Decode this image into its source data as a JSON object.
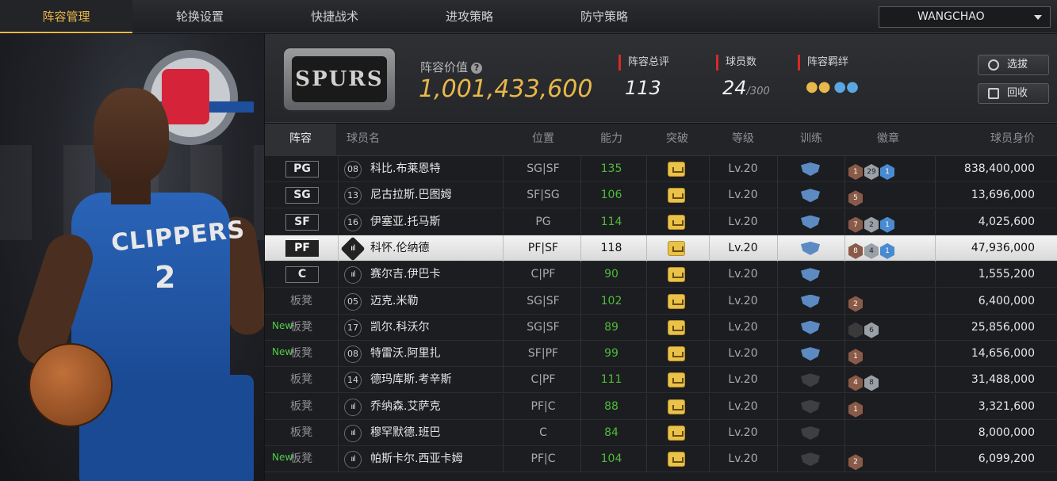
{
  "nav": {
    "tabs": [
      {
        "label": "阵容管理",
        "active": true
      },
      {
        "label": "轮换设置",
        "active": false
      },
      {
        "label": "快捷战术",
        "active": false
      },
      {
        "label": "进攻策略",
        "active": false
      },
      {
        "label": "防守策略",
        "active": false
      }
    ],
    "user": "WANGCHAO"
  },
  "team": {
    "logo_text": "SPURS",
    "value_label": "阵容价值",
    "value": "1,001,433,600",
    "rating_label": "阵容总评",
    "rating": "113",
    "players_label": "球员数",
    "players": "24",
    "players_max": "/300",
    "bond_label": "阵容羁绊",
    "btn_select": "选拔",
    "btn_recycle": "回收"
  },
  "player_art": {
    "jersey_text": "CLIPPERS",
    "jersey_number": "2"
  },
  "table": {
    "headers": [
      "阵容",
      "球员名",
      "位置",
      "能力",
      "突破",
      "等级",
      "训练",
      "徽章",
      "球员身价"
    ],
    "rows": [
      {
        "slot": "PG",
        "slot_type": "starter",
        "new": "",
        "jersey": "08",
        "name": "科比.布莱恩特",
        "pos": "SG|SF",
        "ability": "135",
        "level": "Lv.20",
        "train": true,
        "badges": [
          [
            "bronze",
            "1"
          ],
          [
            "silver",
            "29"
          ],
          [
            "gold",
            "1"
          ]
        ],
        "value": "838,400,000"
      },
      {
        "slot": "SG",
        "slot_type": "starter",
        "new": "",
        "jersey": "13",
        "name": "尼古拉斯.巴图姆",
        "pos": "SF|SG",
        "ability": "106",
        "level": "Lv.20",
        "train": true,
        "badges": [
          [
            "bronze",
            "5"
          ]
        ],
        "value": "13,696,000"
      },
      {
        "slot": "SF",
        "slot_type": "starter",
        "new": "",
        "jersey": "16",
        "name": "伊塞亚.托马斯",
        "pos": "PG",
        "ability": "114",
        "level": "Lv.20",
        "train": true,
        "badges": [
          [
            "bronze",
            "7"
          ],
          [
            "silver",
            "2"
          ],
          [
            "gold",
            "1"
          ]
        ],
        "value": "4,025,600"
      },
      {
        "slot": "PF",
        "slot_type": "starter",
        "new": "",
        "jersey": "ııl",
        "name": "科怀.伦纳德",
        "pos": "PF|SF",
        "ability": "118",
        "level": "Lv.20",
        "train": true,
        "badges": [
          [
            "bronze",
            "8"
          ],
          [
            "silver",
            "4"
          ],
          [
            "gold",
            "1"
          ]
        ],
        "value": "47,936,000",
        "selected": true
      },
      {
        "slot": "C",
        "slot_type": "starter",
        "new": "",
        "jersey": "ııl",
        "name": "赛尔吉.伊巴卡",
        "pos": "C|PF",
        "ability": "90",
        "level": "Lv.20",
        "train": true,
        "badges": [],
        "value": "1,555,200"
      },
      {
        "slot": "板凳",
        "slot_type": "bench",
        "new": "",
        "jersey": "05",
        "name": "迈克.米勒",
        "pos": "SG|SF",
        "ability": "102",
        "level": "Lv.20",
        "train": true,
        "badges": [
          [
            "bronze",
            "2"
          ]
        ],
        "value": "6,400,000"
      },
      {
        "slot": "板凳",
        "slot_type": "bench",
        "new": "New",
        "jersey": "17",
        "name": "凯尔.科沃尔",
        "pos": "SG|SF",
        "ability": "89",
        "level": "Lv.20",
        "train": true,
        "badges": [
          [
            "dark",
            "0"
          ],
          [
            "silver",
            "6"
          ]
        ],
        "value": "25,856,000"
      },
      {
        "slot": "板凳",
        "slot_type": "bench",
        "new": "New",
        "jersey": "08",
        "name": "特雷沃.阿里扎",
        "pos": "SF|PF",
        "ability": "99",
        "level": "Lv.20",
        "train": true,
        "badges": [
          [
            "bronze",
            "1"
          ]
        ],
        "value": "14,656,000"
      },
      {
        "slot": "板凳",
        "slot_type": "bench",
        "new": "",
        "jersey": "14",
        "name": "德玛库斯.考辛斯",
        "pos": "C|PF",
        "ability": "111",
        "level": "Lv.20",
        "train": false,
        "badges": [
          [
            "bronze",
            "4"
          ],
          [
            "silver",
            "8"
          ]
        ],
        "value": "31,488,000"
      },
      {
        "slot": "板凳",
        "slot_type": "bench",
        "new": "",
        "jersey": "ııl",
        "name": "乔纳森.艾萨克",
        "pos": "PF|C",
        "ability": "88",
        "level": "Lv.20",
        "train": false,
        "badges": [
          [
            "bronze",
            "1"
          ]
        ],
        "value": "3,321,600"
      },
      {
        "slot": "板凳",
        "slot_type": "bench",
        "new": "",
        "jersey": "ııl",
        "name": "穆罕默德.班巴",
        "pos": "C",
        "ability": "84",
        "level": "Lv.20",
        "train": false,
        "badges": [],
        "value": "8,000,000"
      },
      {
        "slot": "板凳",
        "slot_type": "bench",
        "new": "New",
        "jersey": "ııl",
        "name": "帕斯卡尔.西亚卡姆",
        "pos": "PF|C",
        "ability": "104",
        "level": "Lv.20",
        "train": false,
        "badges": [
          [
            "bronze",
            "2"
          ]
        ],
        "value": "6,099,200"
      }
    ]
  }
}
